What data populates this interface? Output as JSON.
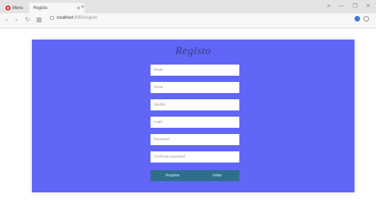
{
  "browser": {
    "tabs": [
      {
        "label": "Menu"
      },
      {
        "label": "Registo"
      }
    ],
    "new_tab_label": "+",
    "window_controls": [
      "≡",
      "—",
      "❐",
      "✕"
    ],
    "address": {
      "host": "localhost",
      "path": ":8000/registo"
    }
  },
  "page": {
    "title": "Registo",
    "fields": [
      {
        "placeholder": "Email"
      },
      {
        "placeholder": "Nome"
      },
      {
        "placeholder": "Apelido"
      },
      {
        "placeholder": "Login"
      },
      {
        "placeholder": "Password"
      },
      {
        "placeholder": "Confirmar password"
      }
    ],
    "buttons": {
      "submit": "Registar",
      "back": "Voltar"
    }
  },
  "colors": {
    "panel": "#6166f7",
    "button": "#2f6f8c"
  }
}
